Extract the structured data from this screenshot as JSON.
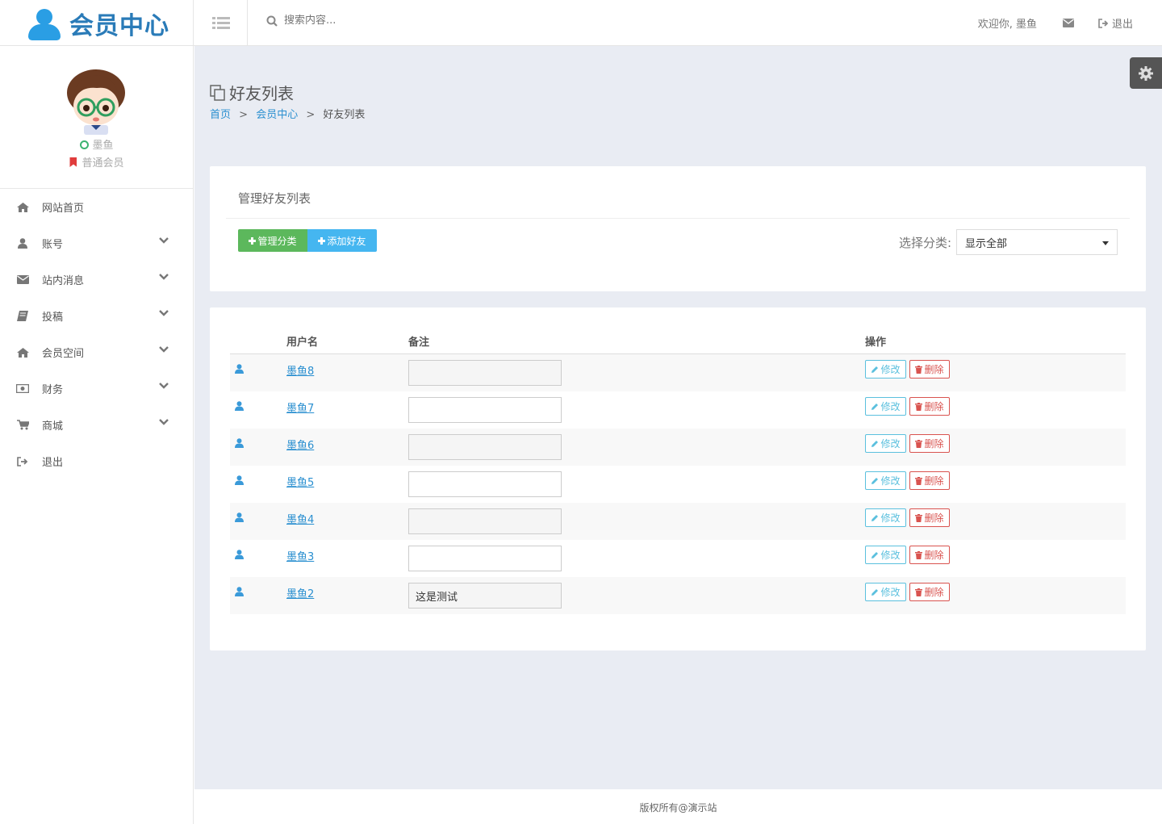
{
  "app": {
    "brand": "会员中心"
  },
  "header": {
    "search_placeholder": "搜索内容...",
    "welcome": "欢迎你, 墨鱼",
    "logout": "退出"
  },
  "profile": {
    "name": "墨鱼",
    "level": "普通会员"
  },
  "sidebar": {
    "items": [
      {
        "label": "网站首页",
        "icon": "home-icon"
      },
      {
        "label": "账号",
        "icon": "user-icon"
      },
      {
        "label": "站内消息",
        "icon": "envelope-icon"
      },
      {
        "label": "投稿",
        "icon": "book-icon"
      },
      {
        "label": "会员空间",
        "icon": "home-icon"
      },
      {
        "label": "财务",
        "icon": "money-icon"
      },
      {
        "label": "商城",
        "icon": "cart-icon"
      },
      {
        "label": "退出",
        "icon": "signout-icon"
      }
    ]
  },
  "page": {
    "title": "好友列表",
    "breadcrumb": {
      "home": "首页",
      "center": "会员中心",
      "current": "好友列表",
      "sep": ">"
    }
  },
  "manage": {
    "heading": "管理好友列表",
    "btn_category": "管理分类",
    "btn_add": "添加好友",
    "category_label": "选择分类:",
    "category_selected": "显示全部"
  },
  "table": {
    "headers": {
      "username": "用户名",
      "note": "备注",
      "action": "操作"
    },
    "edit_label": "修改",
    "delete_label": "删除",
    "rows": [
      {
        "username": "墨鱼8",
        "note": ""
      },
      {
        "username": "墨鱼7",
        "note": ""
      },
      {
        "username": "墨鱼6",
        "note": ""
      },
      {
        "username": "墨鱼5",
        "note": ""
      },
      {
        "username": "墨鱼4",
        "note": ""
      },
      {
        "username": "墨鱼3",
        "note": ""
      },
      {
        "username": "墨鱼2",
        "note": "这是测试"
      }
    ]
  },
  "footer": {
    "copyright": "版权所有@演示站"
  },
  "colors": {
    "primary": "#2a8fd0",
    "success": "#5cb85c",
    "info": "#45b6f0",
    "danger": "#d9534f",
    "bg": "#e9ecf3"
  }
}
